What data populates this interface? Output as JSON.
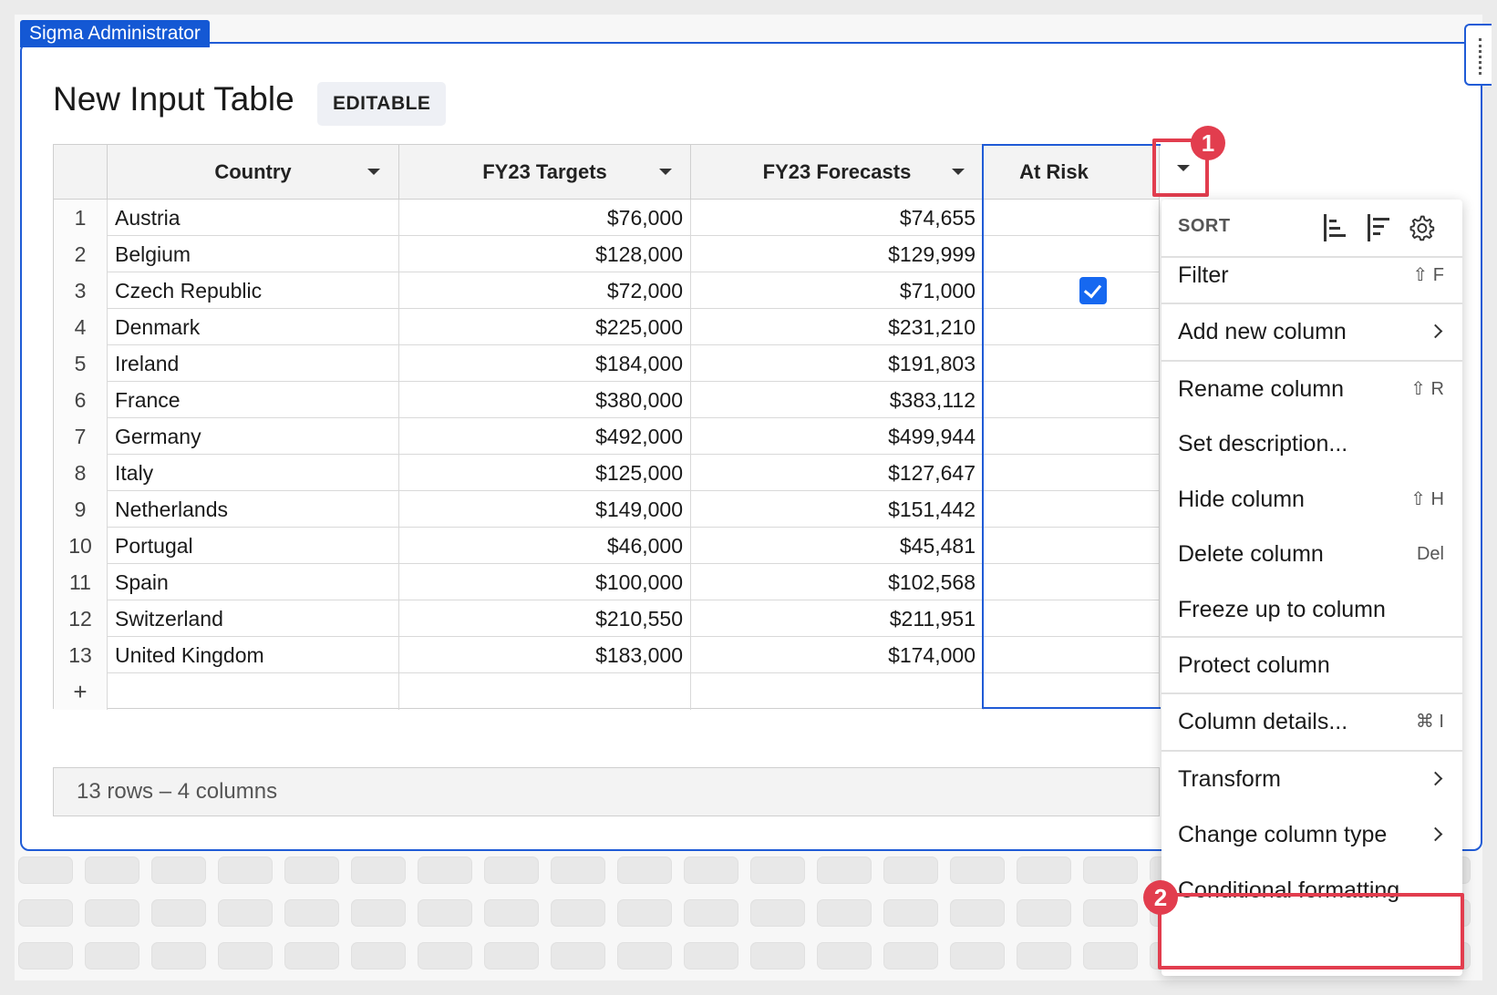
{
  "owner_tag": "Sigma Administrator",
  "title": "New Input Table",
  "badge": "EDITABLE",
  "columns": [
    {
      "label": "Country"
    },
    {
      "label": "FY23 Targets"
    },
    {
      "label": "FY23 Forecasts"
    },
    {
      "label": "At Risk"
    }
  ],
  "rows": [
    {
      "num": "1",
      "country": "Austria",
      "targets": "$76,000",
      "forecasts": "$74,655",
      "at_risk": false
    },
    {
      "num": "2",
      "country": "Belgium",
      "targets": "$128,000",
      "forecasts": "$129,999",
      "at_risk": false
    },
    {
      "num": "3",
      "country": "Czech Republic",
      "targets": "$72,000",
      "forecasts": "$71,000",
      "at_risk": true
    },
    {
      "num": "4",
      "country": "Denmark",
      "targets": "$225,000",
      "forecasts": "$231,210",
      "at_risk": false
    },
    {
      "num": "5",
      "country": "Ireland",
      "targets": "$184,000",
      "forecasts": "$191,803",
      "at_risk": false
    },
    {
      "num": "6",
      "country": "France",
      "targets": "$380,000",
      "forecasts": "$383,112",
      "at_risk": false
    },
    {
      "num": "7",
      "country": "Germany",
      "targets": "$492,000",
      "forecasts": "$499,944",
      "at_risk": false
    },
    {
      "num": "8",
      "country": "Italy",
      "targets": "$125,000",
      "forecasts": "$127,647",
      "at_risk": false
    },
    {
      "num": "9",
      "country": "Netherlands",
      "targets": "$149,000",
      "forecasts": "$151,442",
      "at_risk": false
    },
    {
      "num": "10",
      "country": "Portugal",
      "targets": "$46,000",
      "forecasts": "$45,481",
      "at_risk": false
    },
    {
      "num": "11",
      "country": "Spain",
      "targets": "$100,000",
      "forecasts": "$102,568",
      "at_risk": false
    },
    {
      "num": "12",
      "country": "Switzerland",
      "targets": "$210,550",
      "forecasts": "$211,951",
      "at_risk": false
    },
    {
      "num": "13",
      "country": "United Kingdom",
      "targets": "$183,000",
      "forecasts": "$174,000",
      "at_risk": false
    }
  ],
  "add_row_symbol": "+",
  "footer": "13 rows – 4 columns",
  "menu": {
    "sort_label": "SORT",
    "items": [
      {
        "label": "Filter",
        "shortcut": "⇧ F"
      },
      {
        "label": "Add new column",
        "submenu": true
      },
      {
        "label": "Rename column",
        "shortcut": "⇧ R"
      },
      {
        "label": "Set description..."
      },
      {
        "label": "Hide column",
        "shortcut": "⇧ H"
      },
      {
        "label": "Delete column",
        "shortcut": "Del"
      },
      {
        "label": "Freeze up to column"
      },
      {
        "label": "Protect column"
      },
      {
        "label": "Column details...",
        "shortcut": "⌘ I"
      },
      {
        "label": "Transform",
        "submenu": true
      },
      {
        "label": "Change column type",
        "submenu": true
      },
      {
        "label": "Conditional formatting"
      }
    ]
  },
  "annotations": {
    "step1": "1",
    "step2": "2"
  },
  "colors": {
    "accent": "#1f5bd6",
    "annotation": "#e23d4e",
    "checkbox": "#1668f0"
  }
}
